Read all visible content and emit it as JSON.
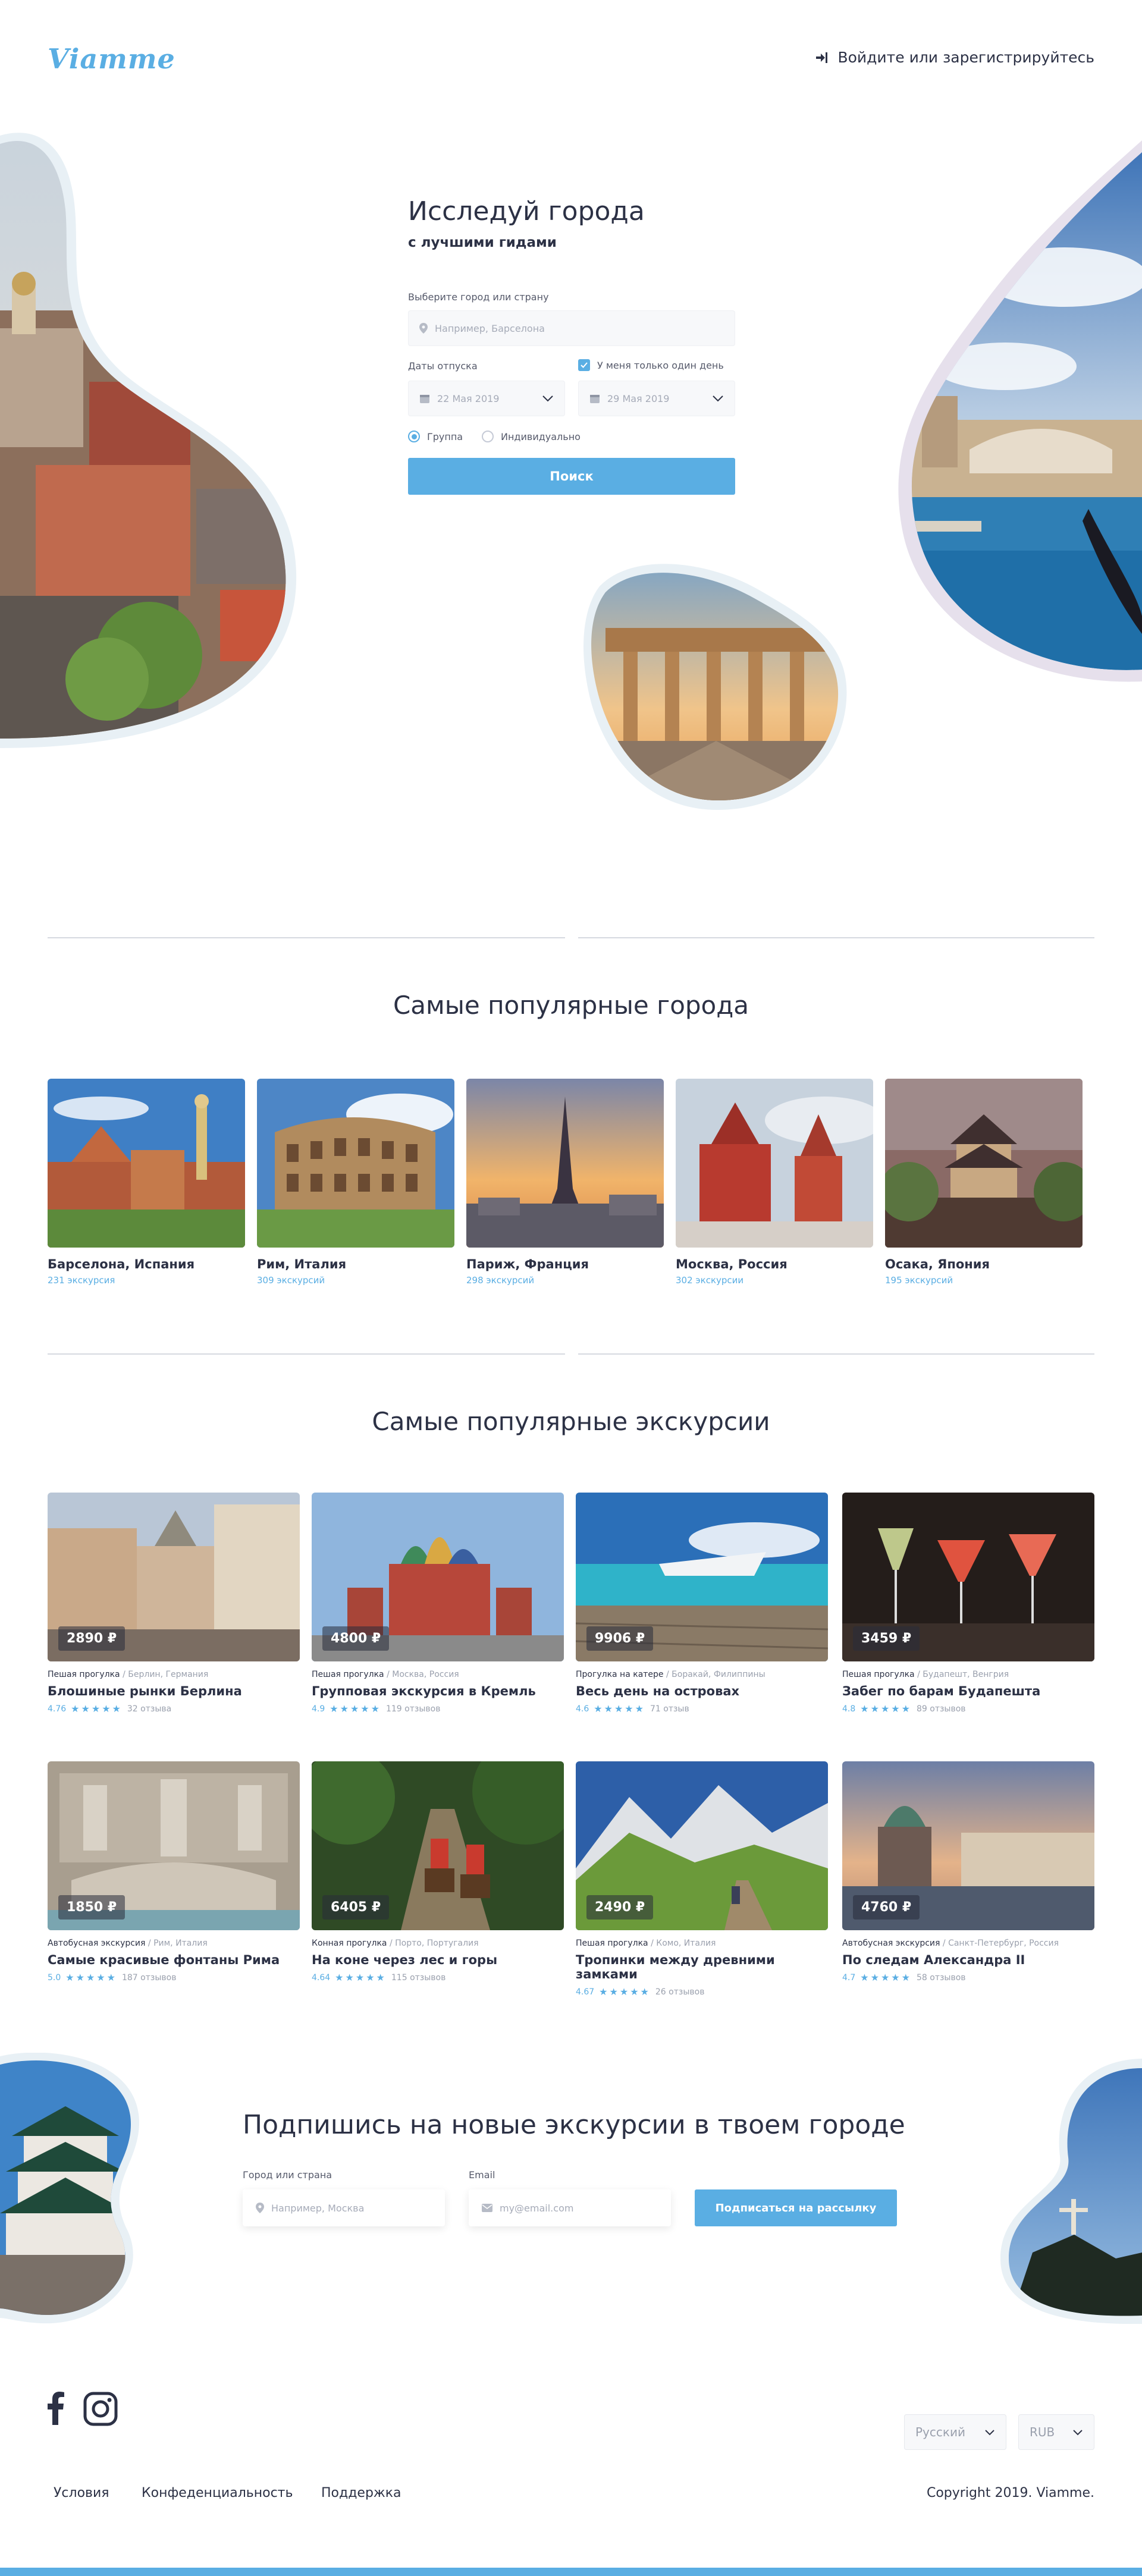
{
  "header": {
    "logo": "Viamme",
    "login_label": "Войдите или зарегистрируйтесь"
  },
  "hero": {
    "title": "Исследуй города",
    "subtitle": "с лучшими гидами",
    "city_label": "Выберите город или страну",
    "city_placeholder": "Например, Барселона",
    "dates_label": "Даты отпуска",
    "one_day_label": "У меня только один день",
    "date_from": "22 Мая 2019",
    "date_to": "29 Мая 2019",
    "group_label": "Группа",
    "individual_label": "Индивидуально",
    "search_button": "Поиск"
  },
  "cities": {
    "title": "Самые популярные города",
    "items": [
      {
        "name": "Барселона, Испания",
        "count": "231 экскурсия"
      },
      {
        "name": "Рим, Италия",
        "count": "309 экскурсий"
      },
      {
        "name": "Париж, Франция",
        "count": "298 экскурсий"
      },
      {
        "name": "Москва, Россия",
        "count": "302 экскурсии"
      },
      {
        "name": "Осака, Япония",
        "count": "195 экскурсий"
      }
    ]
  },
  "tours": {
    "title": "Самые популярные экскурсии",
    "items": [
      {
        "price": "2890 ₽",
        "type": "Пешая прогулка",
        "location": "/ Берлин, Германия",
        "name": "Блошиные рынки Берлина",
        "score": "4.76",
        "reviews": "32 отзыва"
      },
      {
        "price": "4800 ₽",
        "type": "Пешая прогулка",
        "location": "/ Москва, Россия",
        "name": "Групповая экскурсия в Кремль",
        "score": "4.9",
        "reviews": "119 отзывов"
      },
      {
        "price": "9906 ₽",
        "type": "Прогулка на катере",
        "location": "/ Боракай, Филиппины",
        "name": "Весь день на островах",
        "score": "4.6",
        "reviews": "71 отзыв"
      },
      {
        "price": "3459 ₽",
        "type": "Пешая прогулка",
        "location": "/ Будапешт, Венгрия",
        "name": "Забег по барам Будапешта",
        "score": "4.8",
        "reviews": "89 отзывов"
      },
      {
        "price": "1850 ₽",
        "type": "Автобусная экскурсия",
        "location": "/ Рим, Италия",
        "name": "Самые красивые фонтаны Рима",
        "score": "5.0",
        "reviews": "187 отзывов"
      },
      {
        "price": "6405 ₽",
        "type": "Конная прогулка",
        "location": "/ Порто, Португалия",
        "name": "На коне через лес и горы",
        "score": "4.64",
        "reviews": "115 отзывов"
      },
      {
        "price": "2490 ₽",
        "type": "Пешая прогулка",
        "location": "/ Комо, Италия",
        "name": "Тропинки между древними замками",
        "score": "4.67",
        "reviews": "26 отзывов"
      },
      {
        "price": "4760 ₽",
        "type": "Автобусная экскурсия",
        "location": "/ Санкт-Петербург, Россия",
        "name": "По следам Александра II",
        "score": "4.7",
        "reviews": "58 отзывов"
      }
    ]
  },
  "subscribe": {
    "title": "Подпишись на новые экскурсии в твоем городе",
    "city_label": "Город или страна",
    "city_placeholder": "Например, Москва",
    "email_label": "Email",
    "email_placeholder": "my@email.com",
    "button": "Подписаться на рассылку"
  },
  "footer": {
    "language": "Русский",
    "currency": "RUB",
    "links": [
      "Условия",
      "Конфеденциальность",
      "Поддержка"
    ],
    "copyright": "Copyright 2019. Viamme."
  },
  "colors": {
    "accent": "#5aaee3",
    "text": "#2c3145",
    "divider": "#d6d9e0"
  }
}
